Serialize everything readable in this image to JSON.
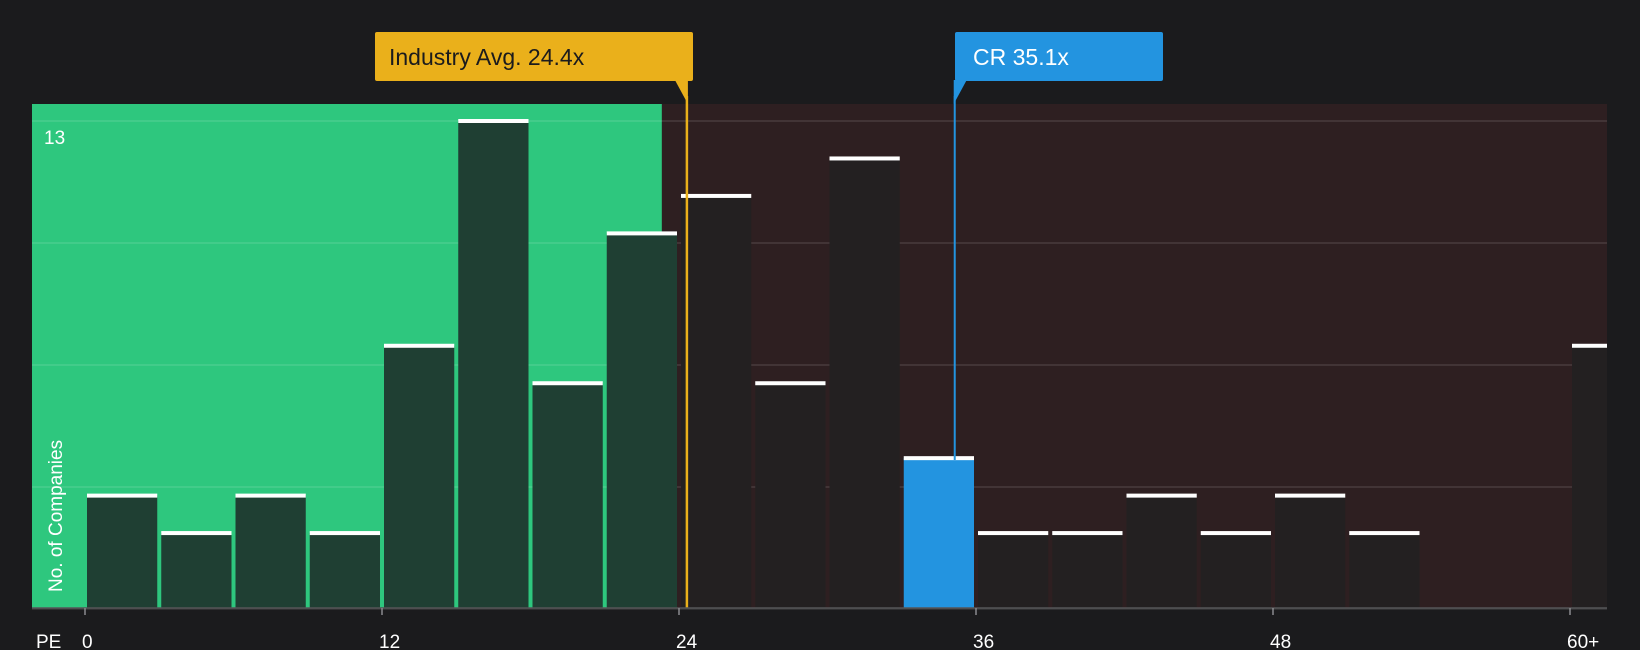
{
  "chart_data": {
    "type": "bar",
    "title": "",
    "xlabel": "PE",
    "ylabel": "No. of Companies",
    "y_max_label": "13",
    "x_ticks": [
      "0",
      "12",
      "24",
      "36",
      "48",
      "60+"
    ],
    "bin_width": 3,
    "bins": [
      {
        "start": 0,
        "value": 3
      },
      {
        "start": 3,
        "value": 2
      },
      {
        "start": 6,
        "value": 3
      },
      {
        "start": 9,
        "value": 2
      },
      {
        "start": 12,
        "value": 7
      },
      {
        "start": 15,
        "value": 13
      },
      {
        "start": 18,
        "value": 6
      },
      {
        "start": 21,
        "value": 10
      },
      {
        "start": 24,
        "value": 11
      },
      {
        "start": 27,
        "value": 6
      },
      {
        "start": 30,
        "value": 12
      },
      {
        "start": 33,
        "value": 4,
        "highlight": true
      },
      {
        "start": 36,
        "value": 2
      },
      {
        "start": 39,
        "value": 2
      },
      {
        "start": 42,
        "value": 3
      },
      {
        "start": 45,
        "value": 2
      },
      {
        "start": 48,
        "value": 3
      },
      {
        "start": 51,
        "value": 2
      },
      {
        "start": 54,
        "value": 0
      },
      {
        "start": 57,
        "value": 0
      },
      {
        "start": 60,
        "value": 7
      }
    ],
    "ylim": [
      0,
      13
    ],
    "industry_avg": {
      "label": "Industry Avg. 24.4x",
      "value": 24.4
    },
    "company": {
      "label": "CR 35.1x",
      "value": 35.1
    },
    "colors": {
      "background": "#1b1b1d",
      "undervalued_zone": "#2ec77e",
      "overvalued_zone": "#2e1f21",
      "bar_in_green": "#1f3f33",
      "bar_in_red": "#232021",
      "highlight_bar": "#2394e0",
      "industry_callout": "#eab01b",
      "company_callout": "#2394e0",
      "bar_cap": "#ffffff"
    }
  }
}
